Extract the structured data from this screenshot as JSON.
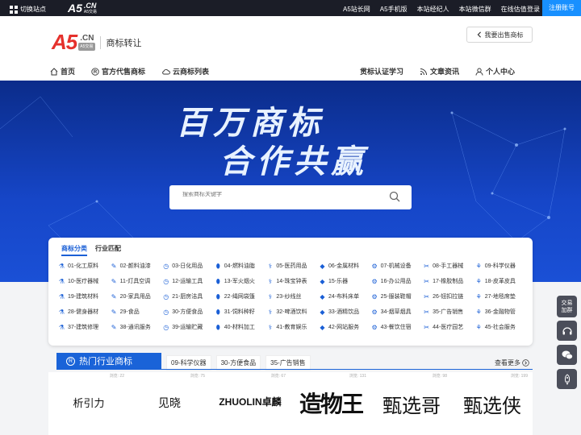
{
  "topbar": {
    "switch_label": "切换站点",
    "logo_text": "A5",
    "logo_suffix": ".CN",
    "logo_sub": "A5交易",
    "links": [
      "A5站长网",
      "A5手机版",
      "本站经纪人",
      "本站微信群",
      "在线估值"
    ],
    "login": "登录",
    "register": "注册账号"
  },
  "header": {
    "brand_a5": "A5",
    "brand_cn": ".CN",
    "brand_badge": "A5交易",
    "brand_title": "商标转让",
    "sell_button": "我要出售商标",
    "nav_left": [
      {
        "label": "首页",
        "icon": "home-icon"
      },
      {
        "label": "官方代售商标",
        "icon": "registered-icon"
      },
      {
        "label": "云商标列表",
        "icon": "cloud-icon"
      }
    ],
    "nav_right": [
      {
        "label": "贯标认证学习",
        "icon": ""
      },
      {
        "label": "文章资讯",
        "icon": "rss-icon"
      },
      {
        "label": "个人中心",
        "icon": "user-icon"
      }
    ]
  },
  "banner": {
    "line1": "百万商标",
    "line2": "合作共赢",
    "search_placeholder": "搜索商标关键字"
  },
  "categories": {
    "tabs": [
      "商标分类",
      "行业匹配"
    ],
    "items": [
      "01-化工原料",
      "02-颜料油漆",
      "03-日化用品",
      "04-燃料油脂",
      "05-医药用品",
      "06-金属材料",
      "07-机械设备",
      "08-手工器械",
      "09-科学仪器",
      "10-医疗器械",
      "11-灯具空调",
      "12-运输工具",
      "13-军火烟火",
      "14-珠宝钟表",
      "15-乐器",
      "16-办公用品",
      "17-橡胶制品",
      "18-皮革皮具",
      "19-建筑材料",
      "20-家具用品",
      "21-厨房洁具",
      "22-绳网袋篷",
      "23-纱线丝",
      "24-布料床单",
      "25-服装鞋帽",
      "26-钮扣拉链",
      "27-地毯席垫",
      "28-健身器材",
      "29-食品",
      "30-方便食品",
      "31-饲料种籽",
      "32-啤酒饮料",
      "33-酒精饮品",
      "34-烟草烟具",
      "35-广告销售",
      "36-金融物管",
      "37-建筑修理",
      "38-通讯服务",
      "39-运输贮藏",
      "40-材料加工",
      "41-教育娱乐",
      "42-网站服务",
      "43-餐饮住宿",
      "44-医疗园艺",
      "45-社会服务"
    ]
  },
  "hot": {
    "title": "热门行业商标",
    "tabs": [
      "09-科学仪器",
      "30-方便食品",
      "35-广告销售"
    ],
    "more": "查看更多",
    "marks": [
      {
        "name": "析引力",
        "views": "浏览: 22"
      },
      {
        "name": "见晓",
        "views": "浏览: 75"
      },
      {
        "name": "ZHUOLIN卓麟",
        "views": "浏览: 67"
      },
      {
        "name": "造物王",
        "views": "浏览: 131"
      },
      {
        "name": "甄选哥",
        "views": "浏览: 98"
      },
      {
        "name": "甄选侠",
        "views": "浏览: 199"
      }
    ]
  },
  "side": {
    "group_label_1": "交易",
    "group_label_2": "加群"
  },
  "colors": {
    "accent": "#1a63d8",
    "brand_red": "#e5312c",
    "topbar": "#1b1d27"
  }
}
